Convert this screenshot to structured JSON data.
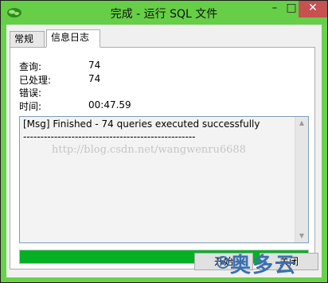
{
  "window": {
    "title": "完成 - 运行 SQL 文件",
    "minimize_glyph": "–",
    "maximize_glyph": "□",
    "close_glyph": "✕",
    "app_icon": "leaf-icon"
  },
  "tabs": [
    {
      "label": "常规",
      "selected": false
    },
    {
      "label": "信息日志",
      "selected": true
    }
  ],
  "stats": {
    "queries_label": "查询:",
    "queries_value": "74",
    "processed_label": "已处理:",
    "processed_value": "74",
    "errors_label": "错误:",
    "errors_value": "",
    "time_label": "时间:",
    "time_value": "00:47.59"
  },
  "log": {
    "line1": "[Msg] Finished - 74 queries executed successfully",
    "line2": "--------------------------------------------------",
    "watermark_url": "http://blog.csdn.net/wangwenru6688"
  },
  "progress": {
    "fraction": 1.0,
    "color": "#06b025"
  },
  "buttons": {
    "start": "开始",
    "close": "关闭"
  },
  "watermark_logo": "奥多云",
  "colors": {
    "titlebar": "#66cf47",
    "close_button": "#c75050"
  }
}
